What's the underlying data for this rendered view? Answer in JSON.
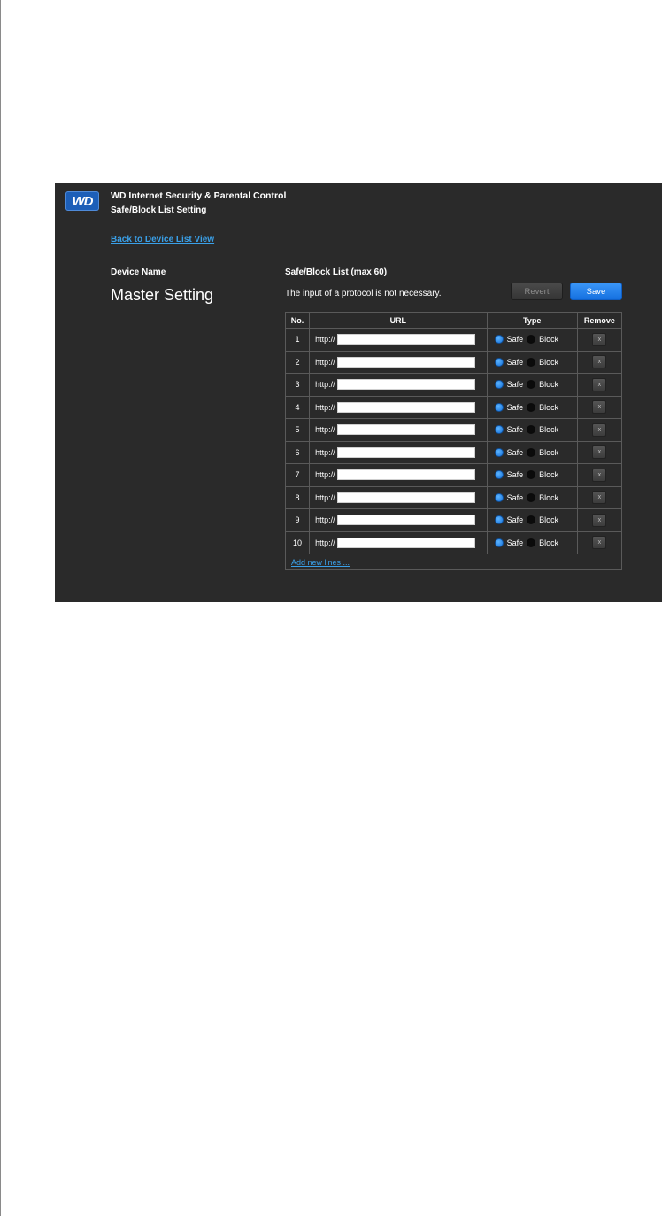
{
  "header": {
    "logo_text": "WD",
    "app_title": "WD Internet Security & Parental Control",
    "page_subtitle": "Safe/Block List Setting",
    "back_link": "Back to Device List View"
  },
  "device": {
    "label": "Device Name",
    "name": "Master Setting"
  },
  "list": {
    "heading": "Safe/Block List (max 60)",
    "note": "The input of a protocol is not necessary.",
    "revert_label": "Revert",
    "save_label": "Save",
    "columns": [
      "No.",
      "URL",
      "Type",
      "Remove"
    ],
    "url_prefix": "http://",
    "safe_label": "Safe",
    "block_label": "Block",
    "remove_label": "x",
    "rows": [
      {
        "no": "1",
        "url": "",
        "type": "Safe"
      },
      {
        "no": "2",
        "url": "",
        "type": "Safe"
      },
      {
        "no": "3",
        "url": "",
        "type": "Safe"
      },
      {
        "no": "4",
        "url": "",
        "type": "Safe"
      },
      {
        "no": "5",
        "url": "",
        "type": "Safe"
      },
      {
        "no": "6",
        "url": "",
        "type": "Safe"
      },
      {
        "no": "7",
        "url": "",
        "type": "Safe"
      },
      {
        "no": "8",
        "url": "",
        "type": "Safe"
      },
      {
        "no": "9",
        "url": "",
        "type": "Safe"
      },
      {
        "no": "10",
        "url": "",
        "type": "Safe"
      }
    ],
    "add_lines": "Add new lines ..."
  },
  "colors": {
    "panel_bg": "#2a2a2a",
    "link": "#3aa0e8",
    "accent": "#1d7af0",
    "logo_bg": "#1d5fb8"
  }
}
